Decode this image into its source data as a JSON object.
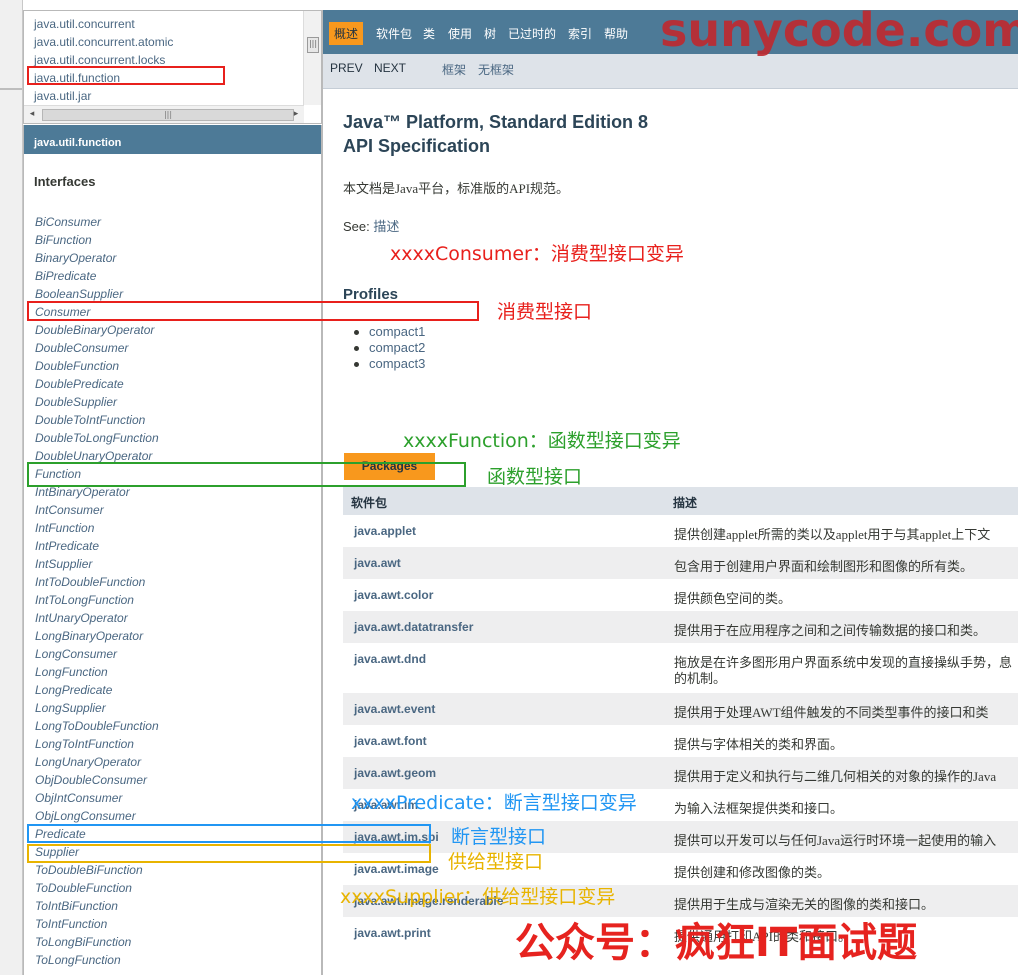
{
  "colors": {
    "header_bg": "#4d7a97",
    "subnav_bg": "#dee3e9",
    "active_tab": "#f8981d",
    "link": "#4a6782",
    "annot_red": "#e8201c",
    "annot_green": "#2ca02c",
    "annot_blue": "#2196f3",
    "annot_yellow": "#e8b400"
  },
  "package_frame": {
    "items": [
      "java.util.concurrent",
      "java.util.concurrent.atomic",
      "java.util.concurrent.locks",
      "java.util.function",
      "java.util.jar"
    ],
    "scroll_glyph": "|||"
  },
  "class_frame": {
    "header": "java.util.function",
    "section_title": "Interfaces",
    "items": [
      "BiConsumer",
      "BiFunction",
      "BinaryOperator",
      "BiPredicate",
      "BooleanSupplier",
      "Consumer",
      "DoubleBinaryOperator",
      "DoubleConsumer",
      "DoubleFunction",
      "DoublePredicate",
      "DoubleSupplier",
      "DoubleToIntFunction",
      "DoubleToLongFunction",
      "DoubleUnaryOperator",
      "Function",
      "IntBinaryOperator",
      "IntConsumer",
      "IntFunction",
      "IntPredicate",
      "IntSupplier",
      "IntToDoubleFunction",
      "IntToLongFunction",
      "IntUnaryOperator",
      "LongBinaryOperator",
      "LongConsumer",
      "LongFunction",
      "LongPredicate",
      "LongSupplier",
      "LongToDoubleFunction",
      "LongToIntFunction",
      "LongUnaryOperator",
      "ObjDoubleConsumer",
      "ObjIntConsumer",
      "ObjLongConsumer",
      "Predicate",
      "Supplier",
      "ToDoubleBiFunction",
      "ToDoubleFunction",
      "ToIntBiFunction",
      "ToIntFunction",
      "ToLongBiFunction",
      "ToLongFunction"
    ]
  },
  "top_nav": {
    "items": [
      "概述",
      "软件包",
      "类",
      "使用",
      "树",
      "已过时的",
      "索引",
      "帮助"
    ]
  },
  "sub_nav": {
    "prev": "PREV",
    "next": "NEXT",
    "frames": "框架",
    "no_frames": "无框架"
  },
  "content": {
    "title_line1": "Java™ Platform, Standard Edition 8",
    "title_line2": "API Specification",
    "description": "本文档是Java平台，标准版的API规范。",
    "see_label": "See:",
    "see_link": "描述",
    "profiles_heading": "Profiles",
    "profiles": [
      "compact1",
      "compact2",
      "compact3"
    ],
    "packages_tab": "Packages",
    "table_headers": [
      "软件包",
      "描述"
    ],
    "rows": [
      {
        "pkg": "java.applet",
        "desc": "提供创建applet所需的类以及applet用于与其applet上下文"
      },
      {
        "pkg": "java.awt",
        "desc": "包含用于创建用户界面和绘制图形和图像的所有类。"
      },
      {
        "pkg": "java.awt.color",
        "desc": "提供颜色空间的类。"
      },
      {
        "pkg": "java.awt.datatransfer",
        "desc": "提供用于在应用程序之间和之间传输数据的接口和类。"
      },
      {
        "pkg": "java.awt.dnd",
        "desc": "拖放是在许多图形用户界面系统中发现的直接操纵手势，息的机制。"
      },
      {
        "pkg": "java.awt.event",
        "desc": "提供用于处理AWT组件触发的不同类型事件的接口和类"
      },
      {
        "pkg": "java.awt.font",
        "desc": "提供与字体相关的类和界面。"
      },
      {
        "pkg": "java.awt.geom",
        "desc": "提供用于定义和执行与二维几何相关的对象的操作的Java"
      },
      {
        "pkg": "java.awt.im",
        "desc": "为输入法框架提供类和接口。"
      },
      {
        "pkg": "java.awt.im.spi",
        "desc": "提供可以开发可以与任何Java运行时环境一起使用的输入"
      },
      {
        "pkg": "java.awt.image",
        "desc": "提供创建和修改图像的类。"
      },
      {
        "pkg": "java.awt.image.renderable",
        "desc": "提供用于生成与渲染无关的图像的类和接口。"
      },
      {
        "pkg": "java.awt.print",
        "desc": "提供通用打印API的类和接口。"
      }
    ]
  },
  "annotations": {
    "consumer_variant": "xxxxConsumer：消费型接口变异",
    "consumer": "消费型接口",
    "function_variant": "xxxxFunction：函数型接口变异",
    "function": "函数型接口",
    "predicate_variant": "xxxxPredicate：断言型接口变异",
    "predicate": "断言型接口",
    "supplier": "供给型接口",
    "supplier_variant": "xxxxSupplier：供给型接口变异"
  },
  "watermark": "sunycode.com",
  "footer_mark": "公众号：疯狂IT面试题"
}
